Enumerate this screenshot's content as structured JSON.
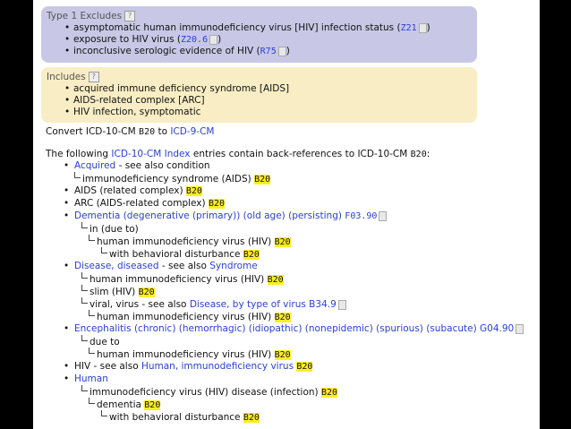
{
  "type1_excludes": {
    "heading": "Type 1 Excludes",
    "help": "?",
    "items": [
      {
        "text": "asymptomatic human immunodeficiency virus [HIV] infection status (",
        "code": "Z21",
        "tail": ")"
      },
      {
        "text": "exposure to HIV virus (",
        "code": "Z20.6",
        "tail": ")"
      },
      {
        "text": "inconclusive serologic evidence of HIV (",
        "code": "R75",
        "tail": ")"
      }
    ]
  },
  "includes": {
    "heading": "Includes",
    "help": "?",
    "items": [
      "acquired immune deficiency syndrome [AIDS]",
      "AIDS-related complex [ARC]",
      "HIV infection, symptomatic"
    ]
  },
  "convert": {
    "prefix": "Convert ICD-10-CM ",
    "code": "B20",
    "to": " to ",
    "link": "ICD-9-CM"
  },
  "index_intro": {
    "prefix": "The following ",
    "link": "ICD-10-CM Index",
    "suffix": " entries contain back-references to ICD-10-CM ",
    "code": "B20",
    "end": ":"
  },
  "index": {
    "acquired": {
      "link": "Acquired",
      "rest": " - see also condition"
    },
    "acquired_sub": {
      "text": "immunodeficiency syndrome (AIDS) ",
      "code": "B20"
    },
    "aids": {
      "text": "AIDS (related complex) ",
      "code": "B20"
    },
    "arc": {
      "text": "ARC (AIDS-related complex) ",
      "code": "B20"
    },
    "dementia": {
      "link": "Dementia (degenerative (primary)) (old age) (persisting) ",
      "code": "F03.90"
    },
    "dementia_in": {
      "text": "in (due to)"
    },
    "dementia_hiv": {
      "text": "human immunodeficiency virus (HIV) ",
      "code": "B20"
    },
    "dementia_beh": {
      "text": "with behavioral disturbance ",
      "code": "B20"
    },
    "disease": {
      "link": "Disease, diseased",
      "rest": " - see also ",
      "link2": "Syndrome"
    },
    "disease_hiv": {
      "text": "human immunodeficiency virus (HIV) ",
      "code": "B20"
    },
    "disease_slim": {
      "text": "slim (HIV) ",
      "code": "B20"
    },
    "disease_viral": {
      "text": "viral, virus - see also ",
      "link": "Disease, by type of virus B34.9"
    },
    "disease_viral_hiv": {
      "text": "human immunodeficiency virus (HIV) ",
      "code": "B20"
    },
    "enceph": {
      "link": "Encephalitis (chronic) (hemorrhagic) (idiopathic) (nonepidemic) (spurious) (subacute) G04.90"
    },
    "enceph_due": {
      "text": "due to"
    },
    "enceph_hiv": {
      "text": "human immunodeficiency virus (HIV) ",
      "code": "B20"
    },
    "hiv": {
      "text": "HIV - see also ",
      "link": "Human, immunodeficiency virus",
      "code": "B20"
    },
    "human": {
      "link": "Human"
    },
    "human_immuno": {
      "text": "immunodeficiency virus (HIV) disease (infection) ",
      "code": "B20"
    },
    "human_dementia": {
      "text": "dementia ",
      "code": "B20"
    },
    "human_beh": {
      "text": "with behavioral disturbance ",
      "code": "B20"
    }
  }
}
